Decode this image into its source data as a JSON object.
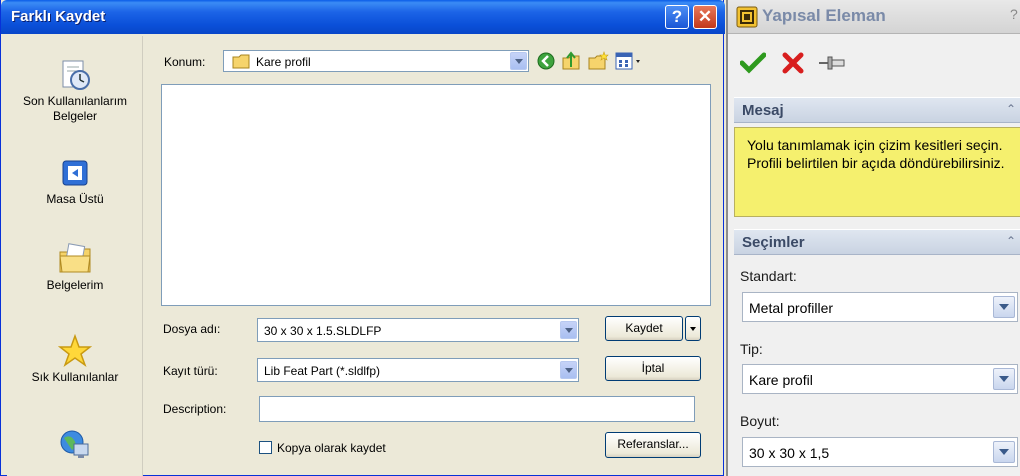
{
  "dialog": {
    "title": "Farklı Kaydet",
    "help_glyph": "?",
    "close_glyph": "✕",
    "location_label": "Konum:",
    "location_value": "Kare profil",
    "places": [
      {
        "label": "Son Kullanılanlarım Belgeler",
        "icon": "recent-documents-icon"
      },
      {
        "label": "Masa Üstü",
        "icon": "desktop-icon"
      },
      {
        "label": "Belgelerim",
        "icon": "my-documents-icon"
      },
      {
        "label": "Sık Kullanılanlar",
        "icon": "favorites-icon"
      },
      {
        "label": "",
        "icon": "network-places-icon"
      }
    ],
    "filename_label": "Dosya adı:",
    "filename_value": "30 x 30 x 1.5.SLDLFP",
    "filetype_label": "Kayıt türü:",
    "filetype_value": "Lib Feat Part (*.sldlfp)",
    "description_label": "Description:",
    "description_value": "",
    "save_copy_label": "Kopya olarak kaydet",
    "save_copy_checked": false,
    "save_button": "Kaydet",
    "cancel_button": "İptal",
    "references_button": "Referanslar..."
  },
  "pm": {
    "title": "Yapısal Eleman",
    "help_glyph": "?",
    "message_header": "Mesaj",
    "message_text": "Yolu tanımlamak için çizim kesitleri seçin. Profili belirtilen bir açıda döndürebilirsiniz.",
    "selections_header": "Seçimler",
    "standard_label": "Standart:",
    "standard_value": "Metal profiller",
    "type_label": "Tip:",
    "type_value": "Kare profil",
    "size_label": "Boyut:",
    "size_value": "30 x 30 x 1,5"
  },
  "colors": {
    "titlebar": "#0a4fd8",
    "message_bg": "#f5f06e",
    "ok_green": "#2e9a1e",
    "cancel_red": "#d81e1e"
  }
}
